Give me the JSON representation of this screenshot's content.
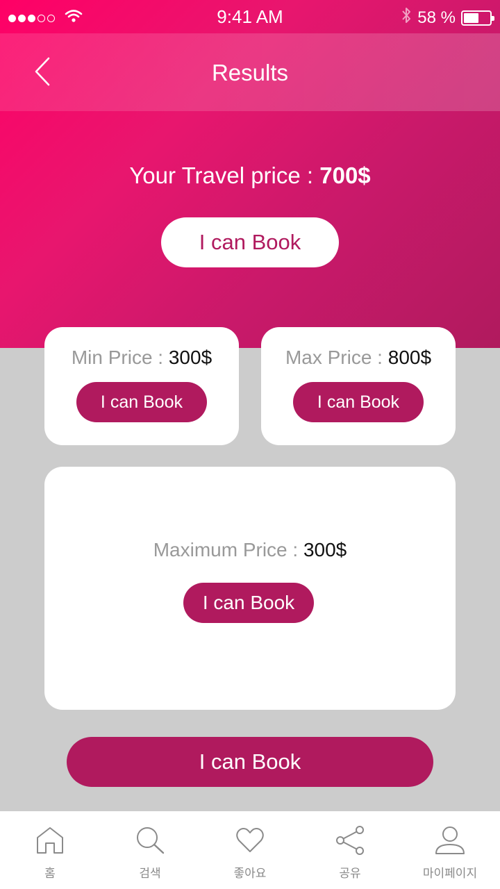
{
  "status_bar": {
    "time": "9:41 AM",
    "battery_text": "58 %",
    "battery_level": 0.58,
    "signal_dots_filled": 3,
    "signal_dots_total": 5,
    "icons": [
      "signal-dots-icon",
      "wifi-icon",
      "bluetooth-icon",
      "battery-icon"
    ]
  },
  "nav": {
    "title": "Results",
    "back_icon": "chevron-left-icon"
  },
  "hero": {
    "price_label": "Your Travel price : ",
    "price_value": "700$",
    "book_label": "I can Book"
  },
  "cards": {
    "min": {
      "label": "Min Price : ",
      "value": "300$",
      "book_label": "I can Book"
    },
    "max": {
      "label": "Max Price : ",
      "value": "800$",
      "book_label": "I can Book"
    },
    "maximum": {
      "label": "Maximum Price : ",
      "value": "300$",
      "book_label": "I can Book"
    }
  },
  "bottom_button": {
    "label": "I can Book"
  },
  "tabbar": {
    "items": [
      {
        "label": "홈",
        "icon": "home-icon"
      },
      {
        "label": "검색",
        "icon": "search-icon"
      },
      {
        "label": "좋아요",
        "icon": "heart-icon"
      },
      {
        "label": "공유",
        "icon": "share-icon"
      },
      {
        "label": "마이페이지",
        "icon": "user-icon"
      }
    ]
  },
  "colors": {
    "accent": "#b01a5e",
    "hero_start": "#ff0066",
    "background": "#cccccc",
    "muted_text": "#999999"
  }
}
